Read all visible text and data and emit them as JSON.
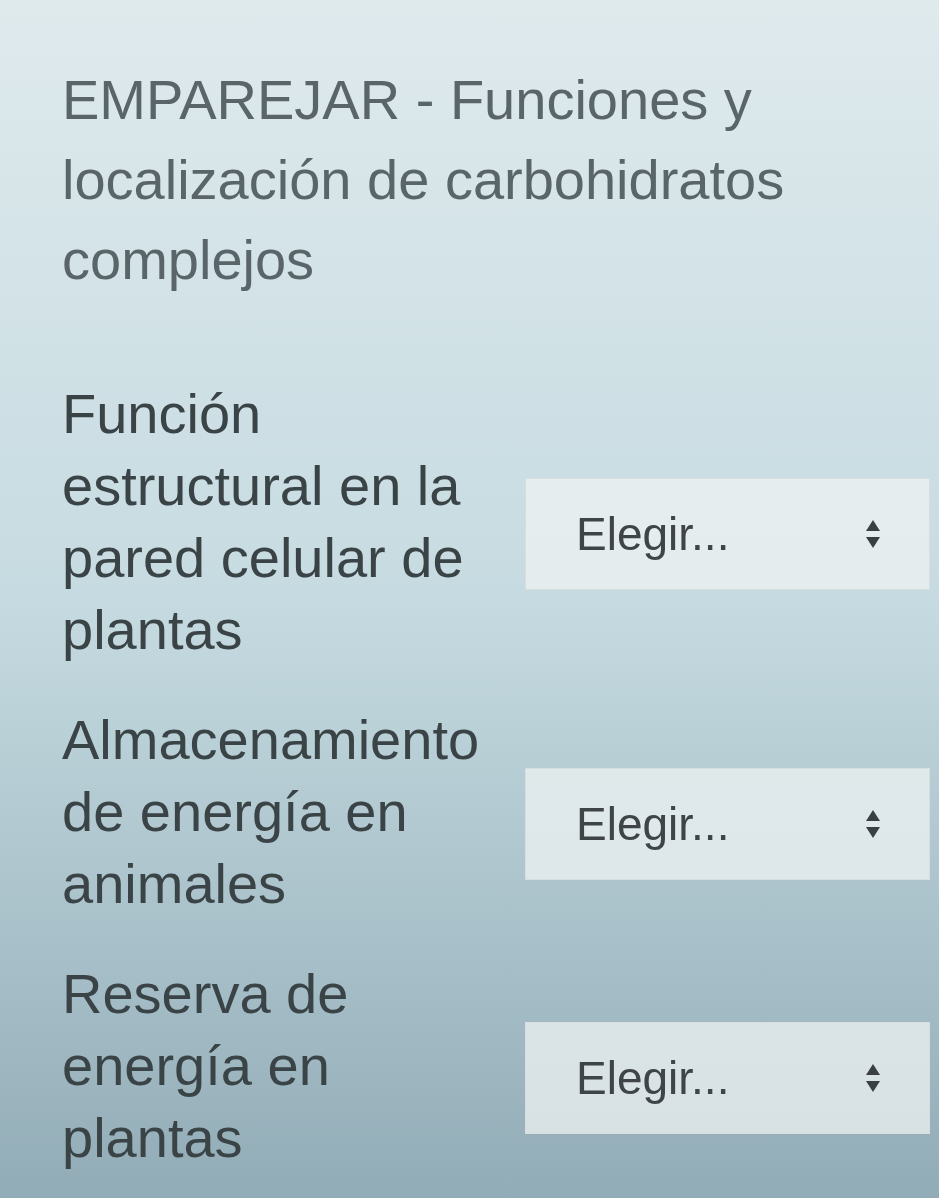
{
  "title": "EMPAREJAR - Funciones y localización de carbohidratos complejos",
  "questions": [
    {
      "prompt": "Función estructural en la pared celular de plantas",
      "answer": {
        "value": "Elegir..."
      }
    },
    {
      "prompt": "Almacenamiento de energía en animales",
      "answer": {
        "value": "Elegir..."
      }
    },
    {
      "prompt": "Reserva de energía en plantas",
      "answer": {
        "value": "Elegir..."
      }
    }
  ]
}
